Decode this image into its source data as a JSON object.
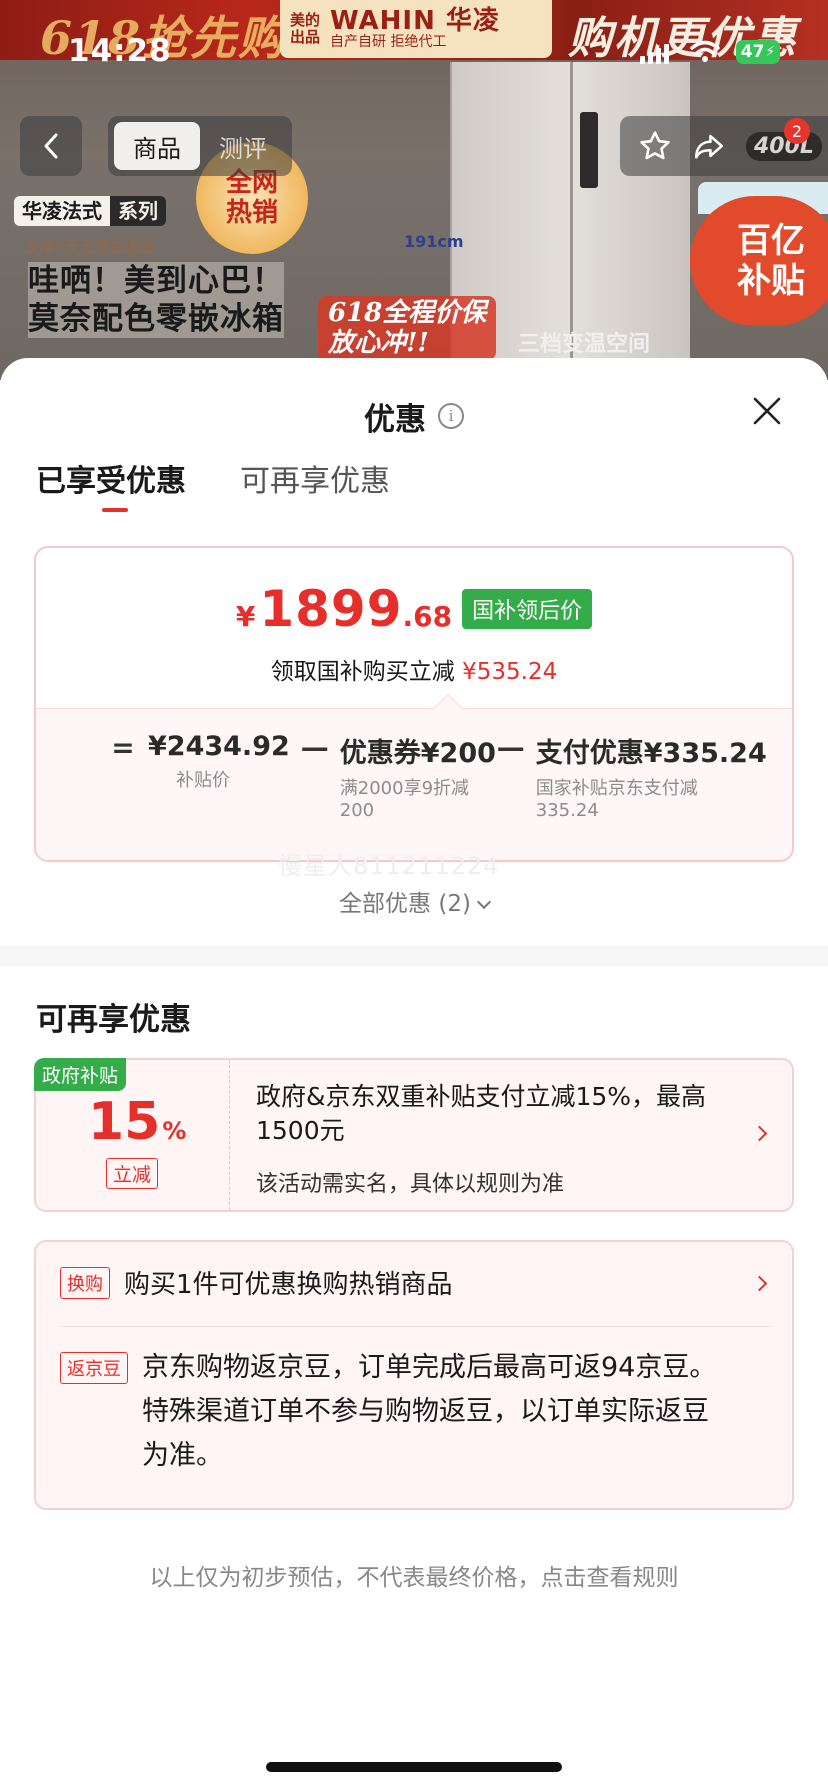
{
  "status_bar": {
    "time": "14:28",
    "battery": "47"
  },
  "banner": {
    "promo_left": "618抢先购",
    "brand_a": "美的\n出品",
    "brand_b": "WAHIN 华凌",
    "brand_c": "自产自研 拒绝代工",
    "promo_right": "购机更优惠",
    "dimension": "191cm",
    "series_name": "华凌法式",
    "series_suffix": "系列",
    "return_note": "支持7天无理由退货",
    "headline_1": "哇哂！美到心巴！",
    "headline_2": "莫奈配色零嵌冰箱",
    "hot_1": "全网",
    "hot_2": "热销",
    "price_guard_1": "618全程价保",
    "price_guard_2": "放心冲!!",
    "zone": "三档变温空间",
    "subsidy_1": "百亿",
    "subsidy_2": "补贴",
    "capacity": "400L",
    "cart_count": "2"
  },
  "nav": {
    "tabs": [
      {
        "label": "商品"
      },
      {
        "label": "测评"
      }
    ]
  },
  "sheet": {
    "title": "优惠",
    "tabs": [
      {
        "label": "已享受优惠"
      },
      {
        "label": "可再享优惠"
      }
    ],
    "price": {
      "currency": "¥",
      "integer": "1899",
      "decimal": ".68",
      "badge": "国补领后价",
      "sub_text": "领取国补购买立减",
      "sub_amount": "¥535.24"
    },
    "formula": {
      "eq": "=",
      "minus": "—",
      "items": [
        {
          "value": "¥2434.92",
          "caption": "补贴价"
        },
        {
          "value": "优惠券¥200",
          "caption": "满2000享9折减200"
        },
        {
          "value": "支付优惠¥335.24",
          "caption": "国家补贴京东支付减335.24"
        }
      ]
    },
    "watermark": "慢星人811211224",
    "all_offers": "全部优惠 (2)",
    "more_title": "可再享优惠",
    "gov_offer": {
      "flag": "政府补贴",
      "pct": "15",
      "pct_sign": "%",
      "tag": "立减",
      "text": "政府&京东双重补贴支付立减15%，最高1500元",
      "note": "该活动需实名，具体以规则为准"
    },
    "combo": {
      "tag1": "换购",
      "text1": "购买1件可优惠换购热销商品",
      "tag2": "返京豆",
      "text2": "京东购物返京豆，订单完成后最高可返94京豆。特殊渠道订单不参与购物返豆，以订单实际返豆为准。"
    },
    "disclaimer": "以上仅为初步预估，不代表最终价格，点击查看规则"
  },
  "colors": {
    "accent_red": "#e62e2a",
    "gov_green": "#35ac4a",
    "card_pink": "#fff5f5"
  }
}
